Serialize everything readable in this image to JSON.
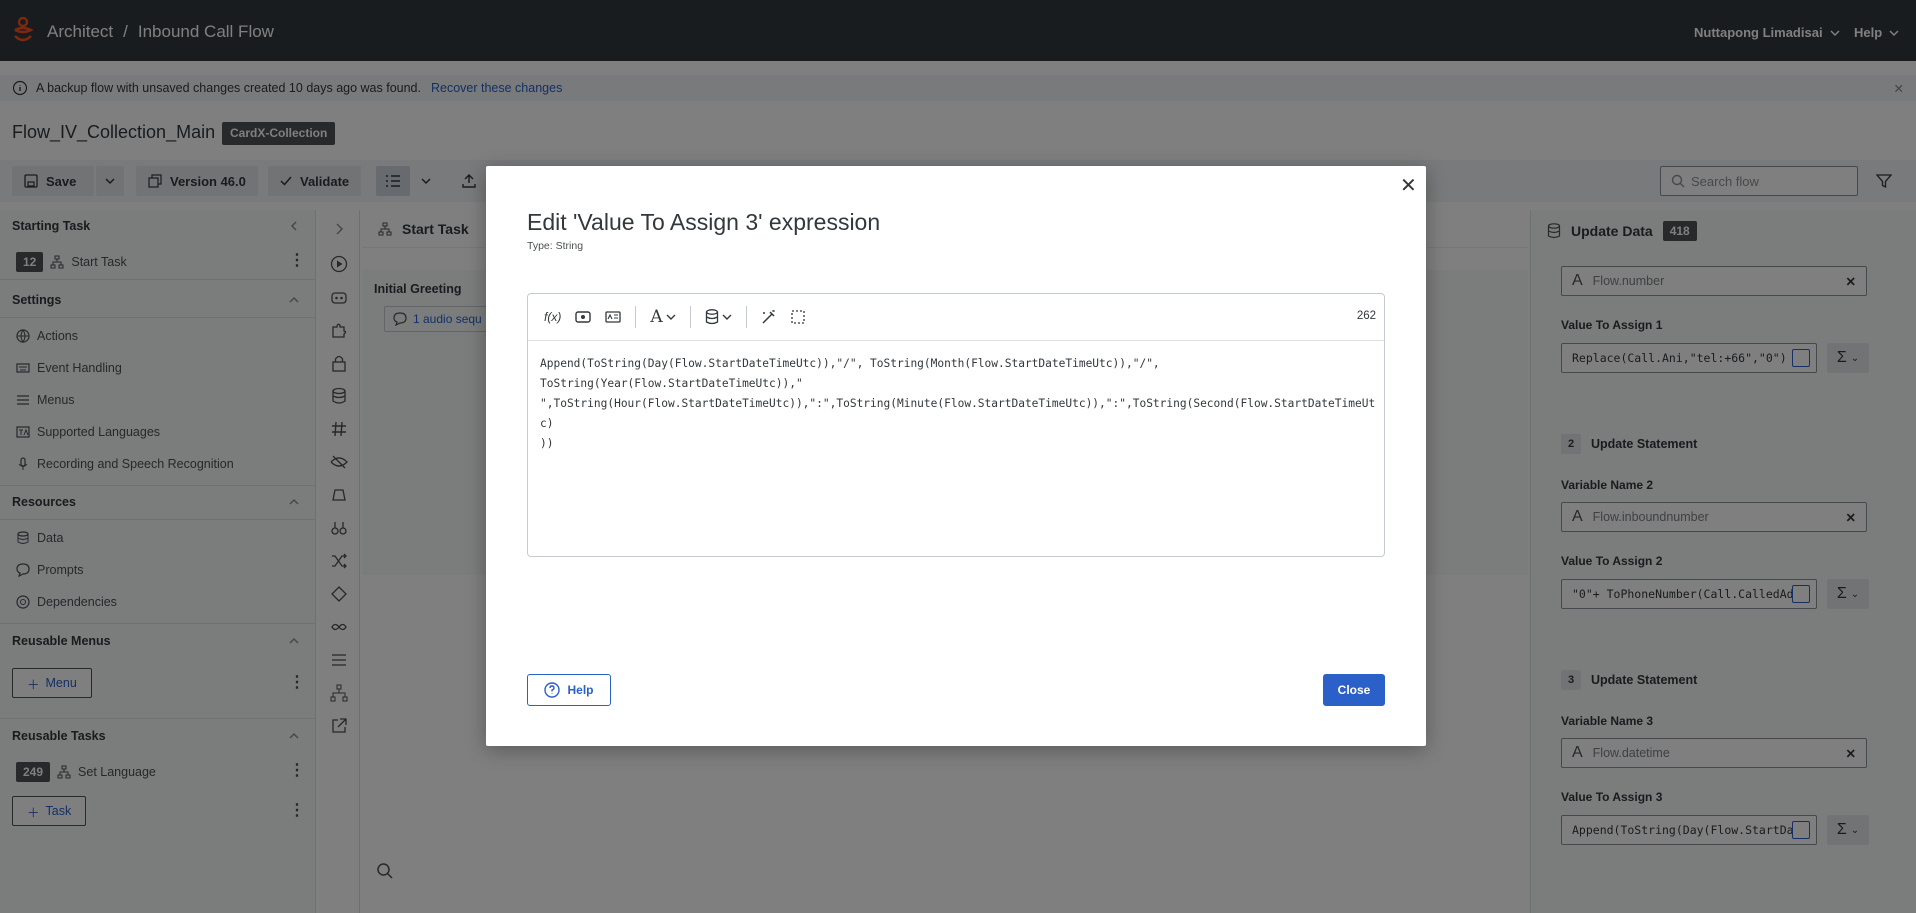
{
  "topbar": {
    "breadcrumb_root": "Architect",
    "breadcrumb_sep": "/",
    "breadcrumb_current": "Inbound Call Flow",
    "user_name": "Nuttapong Limadisai",
    "help_label": "Help"
  },
  "banner": {
    "message": "A backup flow with unsaved changes created 10 days ago was found.",
    "link": "Recover these changes"
  },
  "flow": {
    "name": "Flow_IV_Collection_Main",
    "tag": "CardX-Collection"
  },
  "toolbar": {
    "save_label": "Save",
    "version_label": "Version 46.0",
    "validate_label": "Validate",
    "search_placeholder": "Search flow"
  },
  "left_panel": {
    "starting_task_header": "Starting Task",
    "starting_task_badge": "12",
    "starting_task_name": "Start Task",
    "settings_header": "Settings",
    "settings_items": [
      "Actions",
      "Event Handling",
      "Menus",
      "Supported Languages",
      "Recording and Speech Recognition"
    ],
    "resources_header": "Resources",
    "resources_items": [
      "Data",
      "Prompts",
      "Dependencies"
    ],
    "reusable_menus_header": "Reusable Menus",
    "add_menu_label": "Menu",
    "reusable_tasks_header": "Reusable Tasks",
    "task_badge": "249",
    "task_name": "Set Language",
    "add_task_label": "Task"
  },
  "canvas": {
    "title": "Start Task",
    "greeting_title": "Initial Greeting",
    "greeting_pill": "1 audio sequ"
  },
  "right_panel": {
    "title": "Update Data",
    "badge": "418",
    "field1_value": "Flow.number",
    "value_assign_1_label": "Value To Assign 1",
    "value_assign_1": "Replace(Call.Ani,\"tel:+66\",\"0\")",
    "stmt2_num": "2",
    "stmt2_label": "Update Statement",
    "var_name_2_label": "Variable Name 2",
    "var_name_2": "Flow.inboundnumber",
    "value_assign_2_label": "Value To Assign 2",
    "value_assign_2": "\"0\"+ ToPhoneNumber(Call.CalledAd",
    "stmt3_num": "3",
    "stmt3_label": "Update Statement",
    "var_name_3_label": "Variable Name 3",
    "var_name_3": "Flow.datetime",
    "value_assign_3_label": "Value To Assign 3",
    "value_assign_3": "Append(ToString(Day(Flow.StartDa"
  },
  "modal": {
    "title": "Edit 'Value To Assign 3' expression",
    "type": "Type: String",
    "char_count": "262",
    "expression": "Append(ToString(Day(Flow.StartDateTimeUtc)),\"/\", ToString(Month(Flow.StartDateTimeUtc)),\"/\",\nToString(Year(Flow.StartDateTimeUtc)),\"\n\",ToString(Hour(Flow.StartDateTimeUtc)),\":\",ToString(Minute(Flow.StartDateTimeUtc)),\":\",ToString(Second(Flow.StartDateTimeUtc)\n))",
    "help_label": "Help",
    "close_label": "Close"
  },
  "colors": {
    "topbar": "#33383d",
    "accent": "#2a60c8",
    "badge": "#4f5357"
  }
}
